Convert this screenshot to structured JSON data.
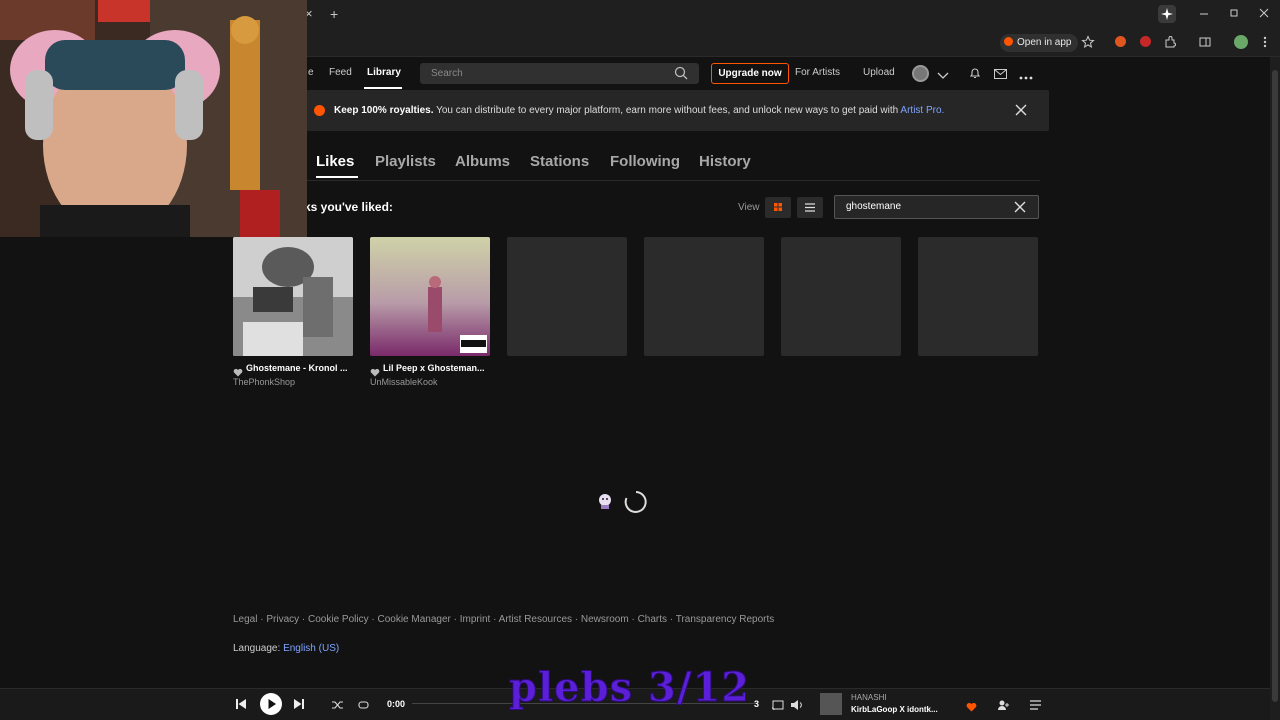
{
  "browser": {
    "new_tab_glyph": "+",
    "close_tab_glyph": "×",
    "open_in_app": "Open in app"
  },
  "nav": {
    "home_partial": "e",
    "feed": "Feed",
    "library": "Library",
    "search_placeholder": "Search",
    "upgrade": "Upgrade now",
    "for_artists": "For Artists",
    "upload": "Upload"
  },
  "banner": {
    "bold": "Keep 100% royalties.",
    "text": " You can distribute to every major platform, earn more without fees, and unlock new ways to get paid with ",
    "link": "Artist Pro."
  },
  "tabs": [
    "Likes",
    "Playlists",
    "Albums",
    "Stations",
    "Following",
    "History"
  ],
  "likes": {
    "heading": "ks you've liked:",
    "view_label": "View",
    "filter_value": "ghostemane"
  },
  "cards": [
    {
      "title": "Ghostemane - Kronol ...",
      "user": "ThePhonkShop"
    },
    {
      "title": "Lil Peep x Ghosteman...",
      "user": "UnMissableKook"
    }
  ],
  "footer": {
    "links": "Legal · Privacy · Cookie Policy · Cookie Manager · Imprint · Artist Resources · Newsroom · Charts · Transparency Reports",
    "language_label": "Language: ",
    "language_value": "English (US)"
  },
  "player": {
    "elapsed": "0:00",
    "duration_partial": "3",
    "artist": "HANASHI",
    "track": "KirbLaGoop X idontk..."
  },
  "overlay_text": "plebs 3/12",
  "colors": {
    "accent": "#ff5500",
    "link": "#7ea4ff",
    "overlay": "#5a1fd6"
  }
}
